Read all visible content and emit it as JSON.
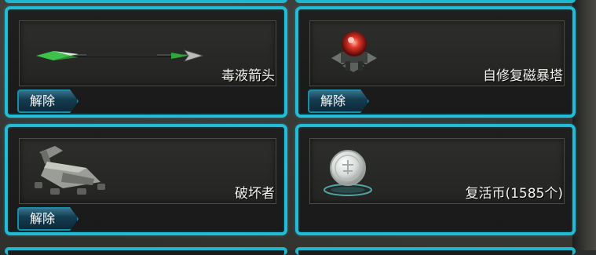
{
  "items": [
    {
      "name": "毒液箭头",
      "icon": "venom-arrow-icon",
      "action_label": "解除"
    },
    {
      "name": "自修复磁暴塔",
      "icon": "tesla-tower-icon",
      "action_label": "解除"
    },
    {
      "name": "破坏者",
      "icon": "destroyer-artillery-icon",
      "action_label": "解除"
    },
    {
      "name": "复活币(1585个)",
      "icon": "revive-coin-icon"
    }
  ],
  "colors": {
    "card_border": "#22bcd6",
    "button_fill": "#12384b",
    "text": "#f4f4f0"
  }
}
